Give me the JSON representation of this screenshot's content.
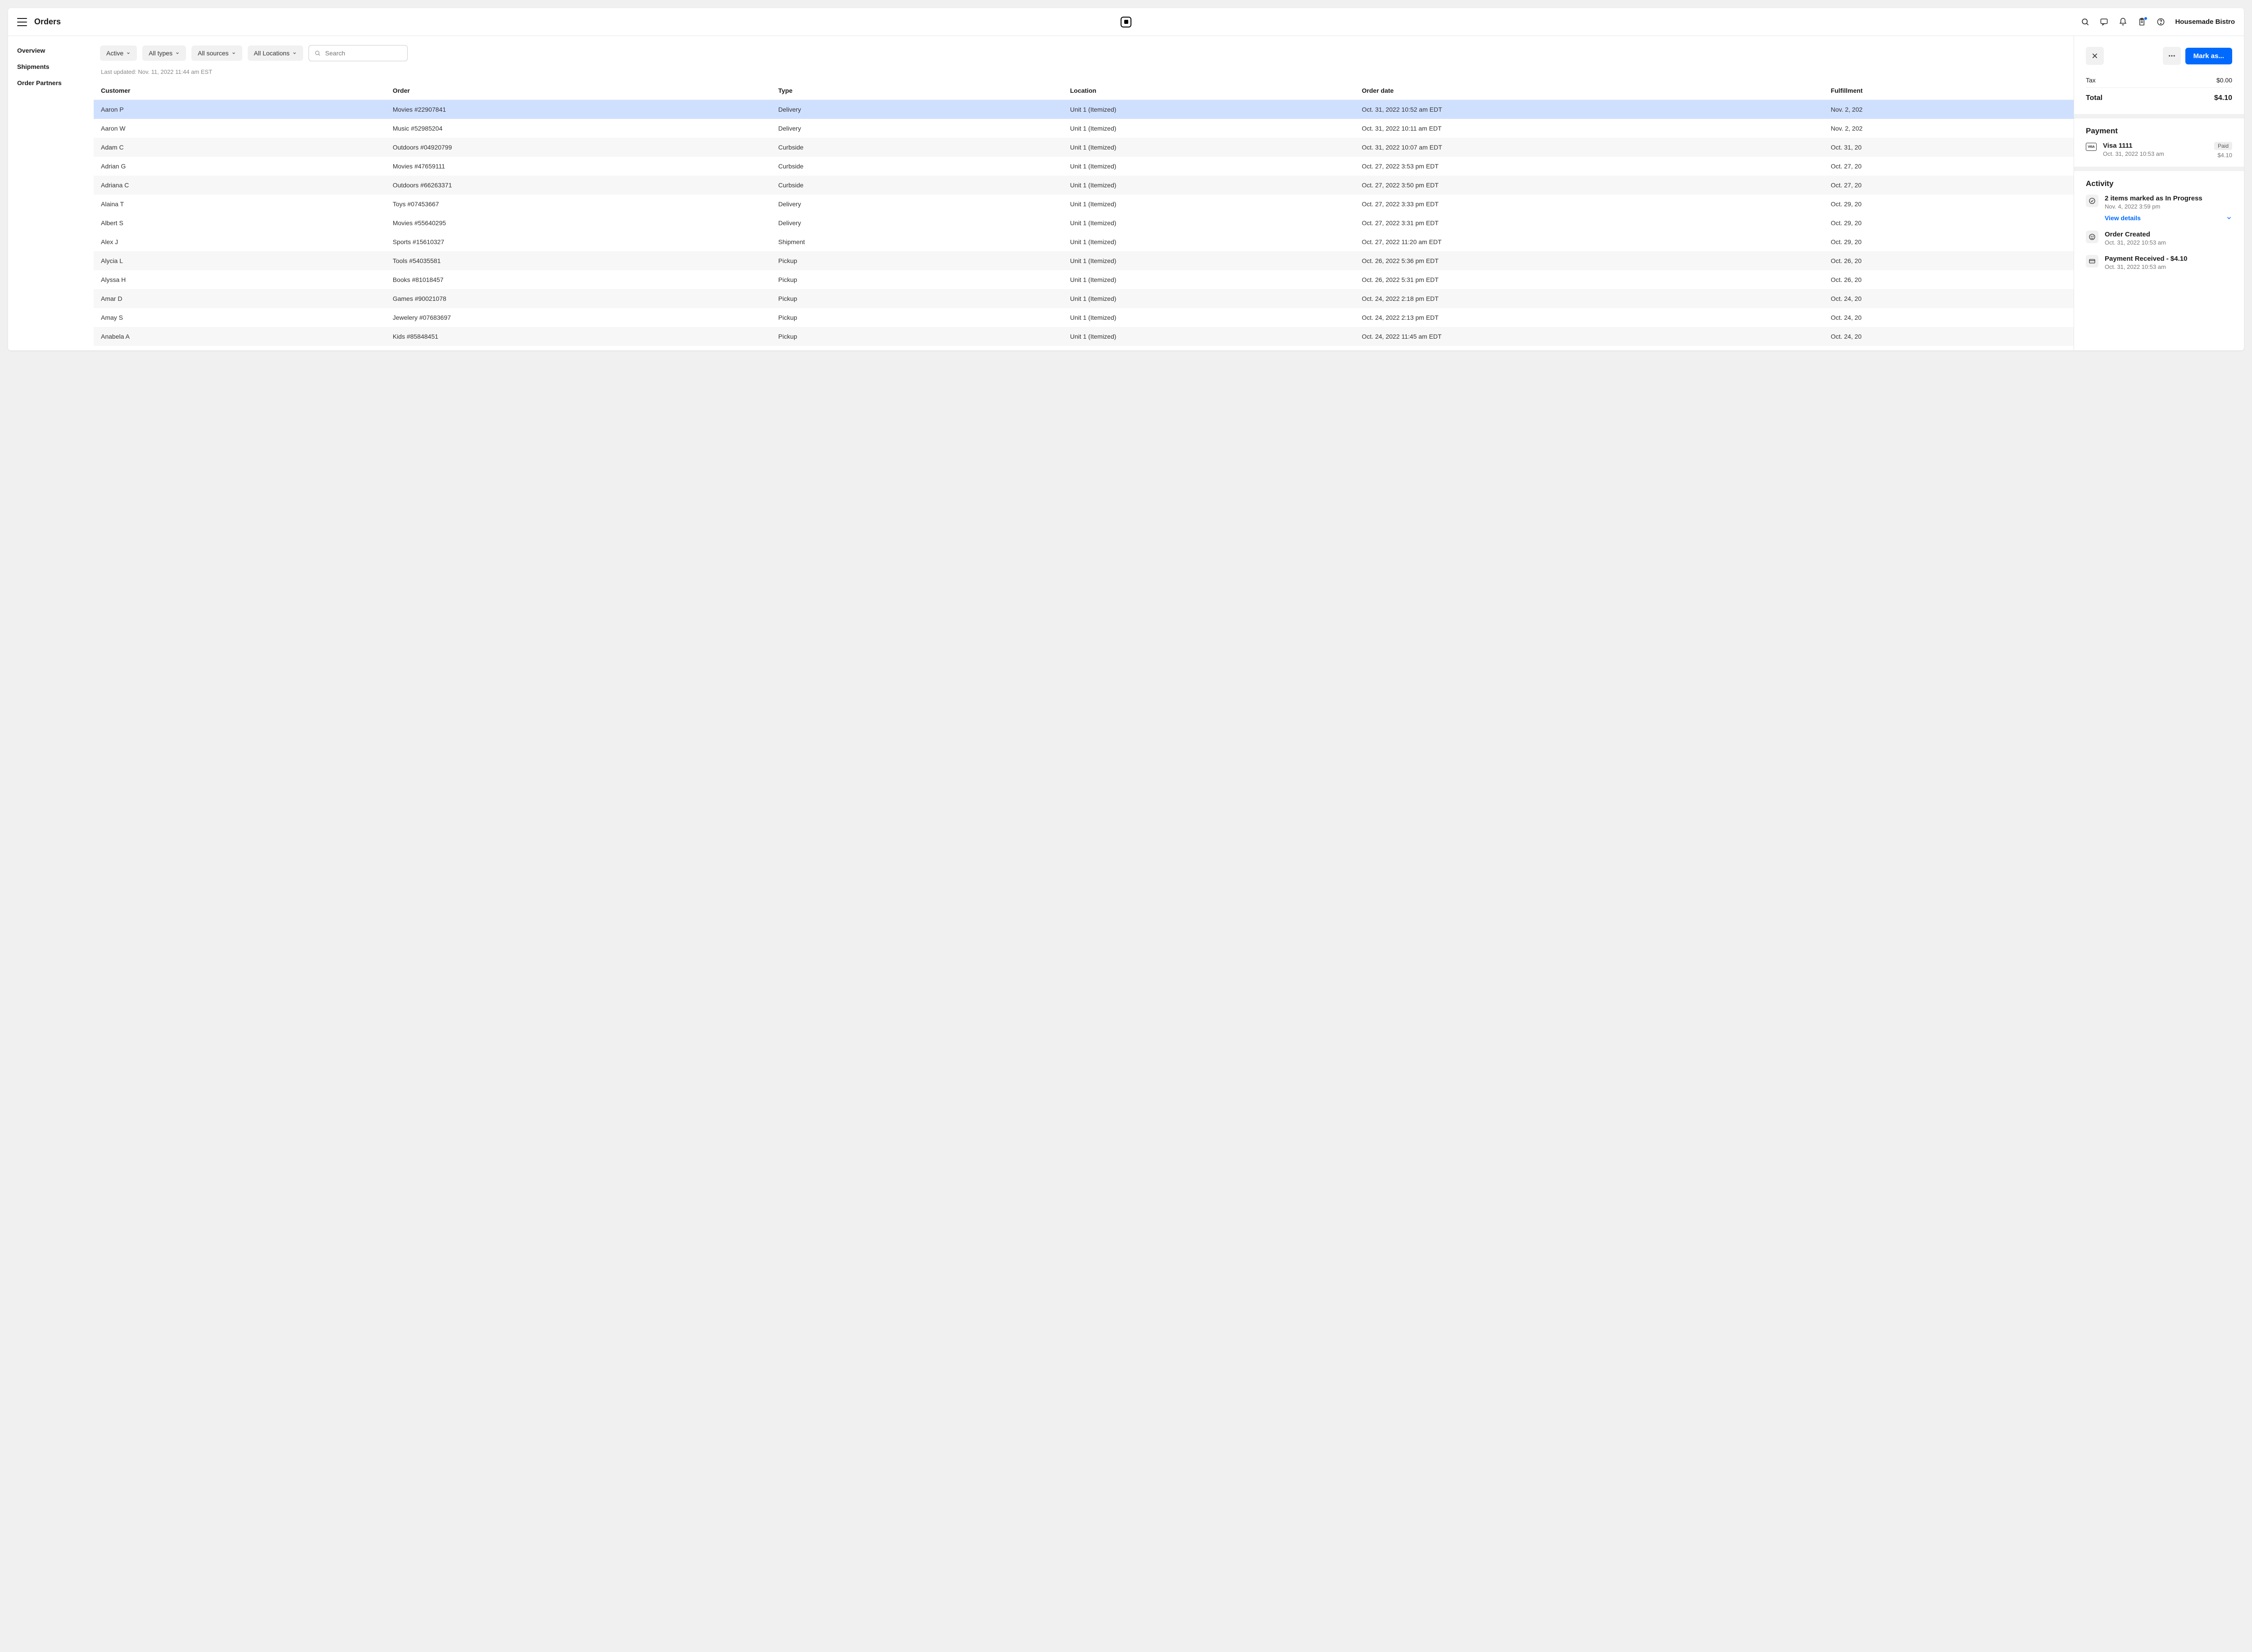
{
  "header": {
    "page_title": "Orders",
    "account_name": "Housemade Bistro"
  },
  "sidebar": {
    "items": [
      {
        "label": "Overview"
      },
      {
        "label": "Shipments"
      },
      {
        "label": "Order Partners"
      }
    ]
  },
  "filters": {
    "status": "Active",
    "types": "All types",
    "sources": "All sources",
    "locations": "All Locations",
    "search_placeholder": "Search"
  },
  "last_updated": "Last updated: Nov. 11, 2022 11:44 am EST",
  "table": {
    "columns": [
      "Customer",
      "Order",
      "Type",
      "Location",
      "Order date",
      "Fulfillment"
    ],
    "rows": [
      {
        "customer": "Aaron P",
        "order": "Movies #22907841",
        "type": "Delivery",
        "location": "Unit 1 (Itemized)",
        "date": "Oct. 31, 2022 10:52 am EDT",
        "fulfillment": "Nov. 2, 202",
        "selected": true
      },
      {
        "customer": "Aaron W",
        "order": "Music #52985204",
        "type": "Delivery",
        "location": "Unit 1 (Itemized)",
        "date": "Oct. 31, 2022 10:11 am EDT",
        "fulfillment": "Nov. 2, 202"
      },
      {
        "customer": "Adam C",
        "order": "Outdoors #04920799",
        "type": "Curbside",
        "location": "Unit 1 (Itemized)",
        "date": "Oct. 31, 2022 10:07 am EDT",
        "fulfillment": "Oct. 31, 20"
      },
      {
        "customer": "Adrian G",
        "order": "Movies #47659111",
        "type": "Curbside",
        "location": "Unit 1 (Itemized)",
        "date": "Oct. 27, 2022 3:53 pm EDT",
        "fulfillment": "Oct. 27, 20"
      },
      {
        "customer": "Adriana C",
        "order": "Outdoors #66263371",
        "type": "Curbside",
        "location": "Unit 1 (Itemized)",
        "date": "Oct. 27, 2022 3:50 pm EDT",
        "fulfillment": "Oct. 27, 20"
      },
      {
        "customer": "Alaina T",
        "order": "Toys #07453667",
        "type": "Delivery",
        "location": "Unit 1 (Itemized)",
        "date": "Oct. 27, 2022 3:33 pm EDT",
        "fulfillment": "Oct. 29, 20"
      },
      {
        "customer": "Albert S",
        "order": "Movies #55640295",
        "type": "Delivery",
        "location": "Unit 1 (Itemized)",
        "date": "Oct. 27, 2022 3:31 pm EDT",
        "fulfillment": "Oct. 29, 20",
        "white": true
      },
      {
        "customer": "Alex J",
        "order": "Sports #15610327",
        "type": "Shipment",
        "location": "Unit 1 (Itemized)",
        "date": "Oct. 27, 2022 11:20 am EDT",
        "fulfillment": "Oct. 29, 20"
      },
      {
        "customer": "Alycia L",
        "order": "Tools #54035581",
        "type": "Pickup",
        "location": "Unit 1 (Itemized)",
        "date": "Oct. 26, 2022 5:36 pm EDT",
        "fulfillment": "Oct. 26, 20"
      },
      {
        "customer": "Alyssa H",
        "order": "Books #81018457",
        "type": "Pickup",
        "location": "Unit 1 (Itemized)",
        "date": "Oct. 26, 2022 5:31 pm EDT",
        "fulfillment": "Oct. 26, 20"
      },
      {
        "customer": "Amar D",
        "order": "Games #90021078",
        "type": "Pickup",
        "location": "Unit 1 (Itemized)",
        "date": "Oct. 24, 2022 2:18 pm EDT",
        "fulfillment": "Oct. 24, 20"
      },
      {
        "customer": "Amay S",
        "order": "Jewelery #07683697",
        "type": "Pickup",
        "location": "Unit 1 (Itemized)",
        "date": "Oct. 24, 2022 2:13 pm EDT",
        "fulfillment": "Oct. 24, 20"
      },
      {
        "customer": "Anabela A",
        "order": "Kids #85848451",
        "type": "Pickup",
        "location": "Unit 1 (Itemized)",
        "date": "Oct. 24, 2022 11:45 am EDT",
        "fulfillment": "Oct. 24, 20"
      }
    ]
  },
  "detail": {
    "mark_as_label": "Mark as...",
    "tax_label": "Tax",
    "tax_value": "$0.00",
    "total_label": "Total",
    "total_value": "$4.10",
    "payment": {
      "section_title": "Payment",
      "method": "Visa 1111",
      "timestamp": "Oct. 31, 2022 10:53 am",
      "status": "Paid",
      "amount": "$4.10"
    },
    "activity": {
      "section_title": "Activity",
      "items": [
        {
          "title": "2 items marked as In Progress",
          "sub": "Nov. 4, 2022 3:59 pm",
          "view_details": "View details",
          "expandable": true,
          "icon": "check"
        },
        {
          "title": "Order Created",
          "sub": "Oct. 31, 2022 10:53 am",
          "icon": "smile"
        },
        {
          "title": "Payment Received - $4.10",
          "sub": "Oct. 31, 2022 10:53 am",
          "icon": "card"
        }
      ]
    }
  }
}
